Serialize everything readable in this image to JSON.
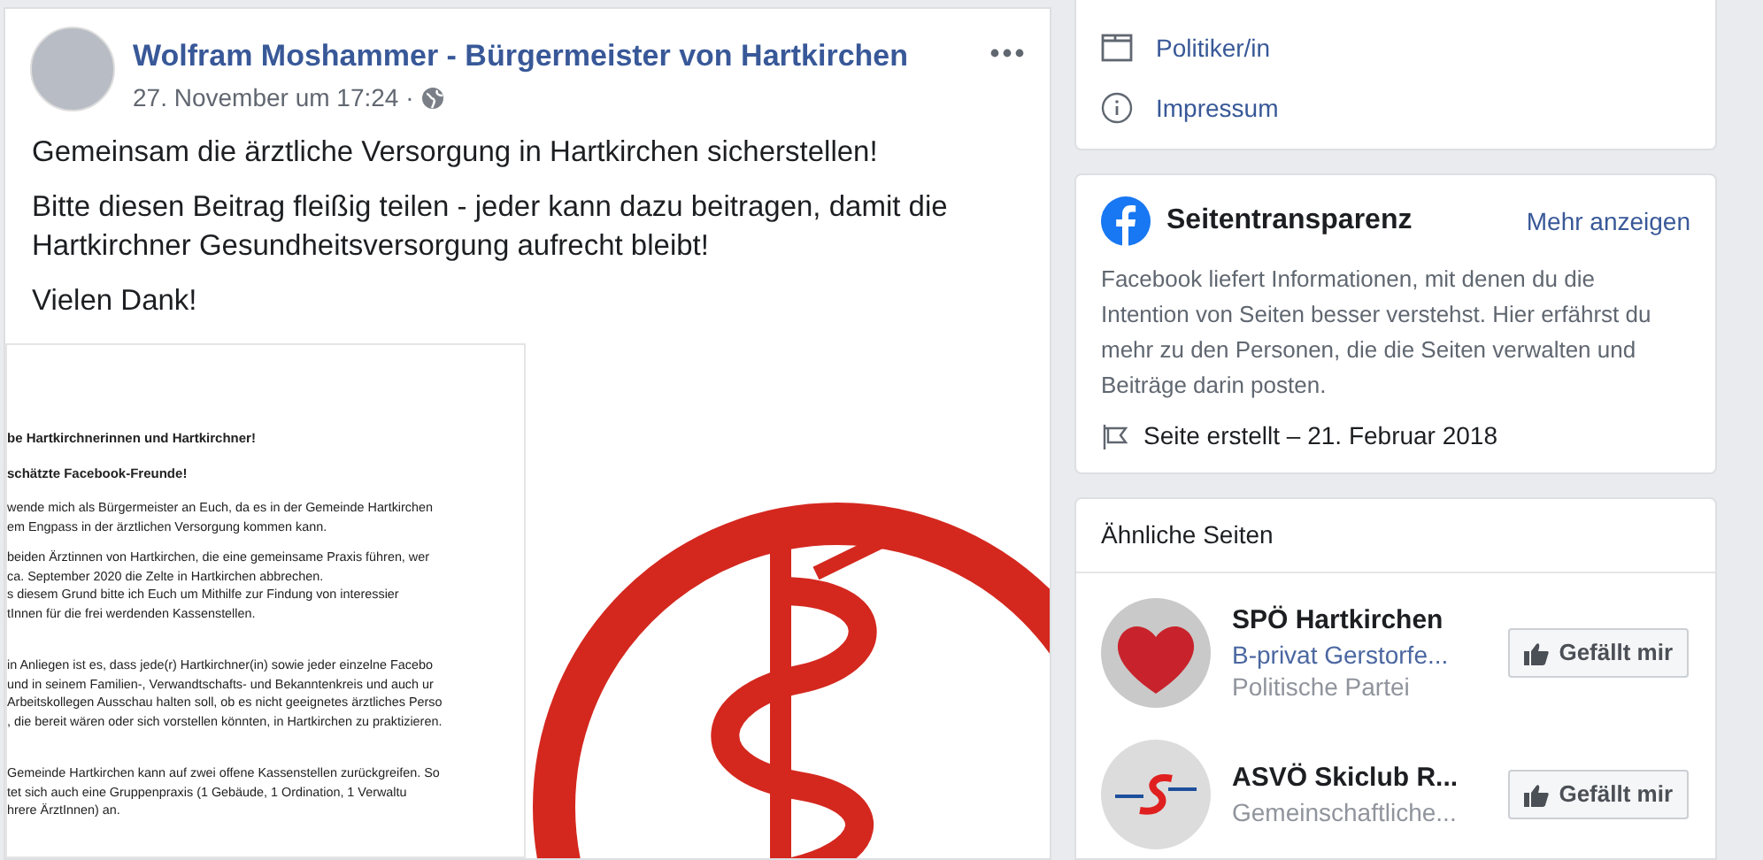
{
  "post": {
    "author": "Wolfram Moshammer - Bürgermeister von Hartkirchen",
    "time": "27. November um 17:24 ·",
    "paragraphs": [
      "Gemeinsam die ärztliche Versorgung in Hartkirchen sicherstellen!",
      "Bitte diesen Beitrag fleißig teilen - jeder kann dazu beitragen, damit die Hartkirchner Gesundheitsversorgung aufrecht bleibt!",
      "Vielen Dank!"
    ],
    "letter": {
      "greetings": [
        "be Hartkirchnerinnen und Hartkirchner!",
        "schätzte Facebook-Freunde!"
      ],
      "paragraphs": [
        [
          "wende mich als Bürgermeister an Euch, da es in der Gemeinde Hartkirchen",
          "em Engpass in der ärztlichen Versorgung kommen kann."
        ],
        [
          "beiden Ärztinnen von Hartkirchen, die eine gemeinsame Praxis führen, wer",
          "ca. September 2020 die Zelte in Hartkirchen abbrechen.",
          "s diesem Grund bitte ich Euch um Mithilfe zur Findung von interessier",
          "tInnen für die frei werdenden Kassenstellen."
        ],
        [
          "in Anliegen ist es, dass jede(r) Hartkirchner(in) sowie jeder einzelne Facebo",
          "und in seinem Familien-, Verwandtschafts- und Bekanntenkreis und auch ur",
          "Arbeitskollegen Ausschau halten soll, ob es nicht geeignetes ärztliches Perso",
          ", die bereit wären oder sich vorstellen könnten, in Hartkirchen zu praktizieren."
        ],
        [
          "Gemeinde Hartkirchen kann auf zwei offene Kassenstellen zurückgreifen. So",
          "tet sich auch eine Gruppenpraxis (1 Gebäude, 1 Ordination, 1 Verwaltu",
          "hrere ÄrztInnen) an."
        ]
      ]
    }
  },
  "sidebar": {
    "about_items": [
      {
        "kind": "category",
        "label": "Politiker/in"
      },
      {
        "kind": "info",
        "label": "Impressum"
      }
    ],
    "transparency": {
      "title": "Seitentransparenz",
      "action": "Mehr anzeigen",
      "description": "Facebook liefert Informationen, mit denen du die Intention von Seiten besser verstehst. Hier erfährst du mehr zu den Personen, die die Seiten verwalten und Beiträge darin posten.",
      "created": "Seite erstellt – 21. Februar 2018"
    },
    "similar_pages": {
      "title": "Ähnliche Seiten",
      "pages": [
        {
          "kind": "heart",
          "name": "SPÖ Hartkirchen",
          "subtitle": "B-privat Gerstorfe...",
          "category": "Politische Partei",
          "button": "Gefällt mir"
        },
        {
          "kind": "ski",
          "name": "ASVÖ Skiclub R...",
          "category": "Gemeinschaftliche...",
          "button": "Gefällt mir"
        }
      ]
    }
  }
}
